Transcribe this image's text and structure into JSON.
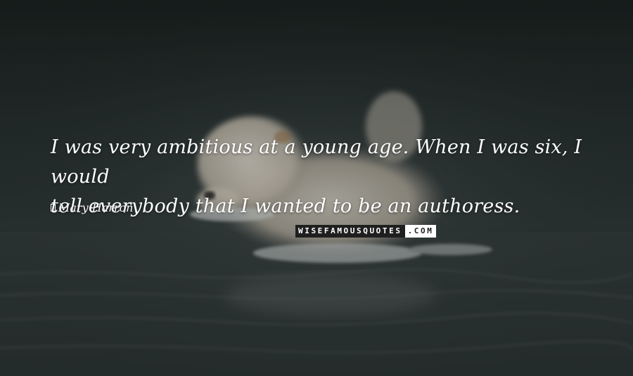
{
  "quote": {
    "line1": "I was very ambitious at a young age. When I was six, I would",
    "line2": "tell everybody that I wanted to be an authoress."
  },
  "author": {
    "name": "Mary Harron"
  },
  "watermark": {
    "left": "WISEFAMOUSQUOTES",
    "right": ".COM"
  },
  "colors": {
    "text": "#ffffff",
    "background": "#2b3433"
  }
}
